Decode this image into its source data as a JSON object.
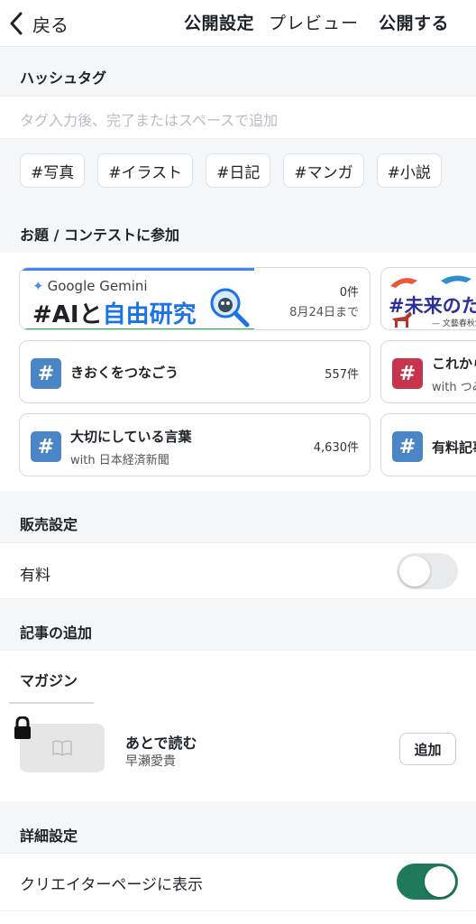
{
  "topbar": {
    "back_label": "戻る",
    "title": "公開設定",
    "preview_label": "プレビュー",
    "publish_label": "公開する"
  },
  "hashtag": {
    "section_label": "ハッシュタグ",
    "input_placeholder": "タグ入力後、完了またはスペースで追加",
    "suggestions": [
      "#写真",
      "#イラスト",
      "#日記",
      "#マンガ",
      "#小説"
    ]
  },
  "contest": {
    "section_label": "お題 / コンテストに参加",
    "banner1": {
      "logo_text": "Google Gemini",
      "headline_a": "#AIと",
      "headline_b": "自由研究",
      "count": "0件",
      "deadline": "8月24日まで"
    },
    "banner2": {
      "headline": "#未来のた",
      "sub": "— 文藝春秋S"
    },
    "topics": [
      {
        "title": "きおくをつなごう",
        "sub": "",
        "count": "557件",
        "color": "#4a86c5"
      },
      {
        "title": "これから",
        "sub": "with つみ",
        "count": "",
        "color": "#c7344e"
      },
      {
        "title": "大切にしている言葉",
        "sub": "with 日本経済新聞",
        "count": "4,630件",
        "color": "#4a86c5"
      },
      {
        "title": "有料記事",
        "sub": "",
        "count": "",
        "color": "#4a86c5"
      }
    ]
  },
  "sales": {
    "section_label": "販売設定",
    "paid_label": "有料",
    "paid_enabled": false
  },
  "article_add": {
    "section_label": "記事の追加",
    "magazine_label": "マガジン",
    "magazine": {
      "name": "あとで読む",
      "owner": "早瀬愛貴",
      "add_button": "追加"
    }
  },
  "details": {
    "section_label": "詳細設定",
    "creator_page_label": "クリエイターページに表示",
    "creator_page_enabled": true
  },
  "colors": {
    "toggle_on": "#1f7a5c",
    "toggle_off": "#e8eaec",
    "gemini_blue": "#1a73e8"
  }
}
